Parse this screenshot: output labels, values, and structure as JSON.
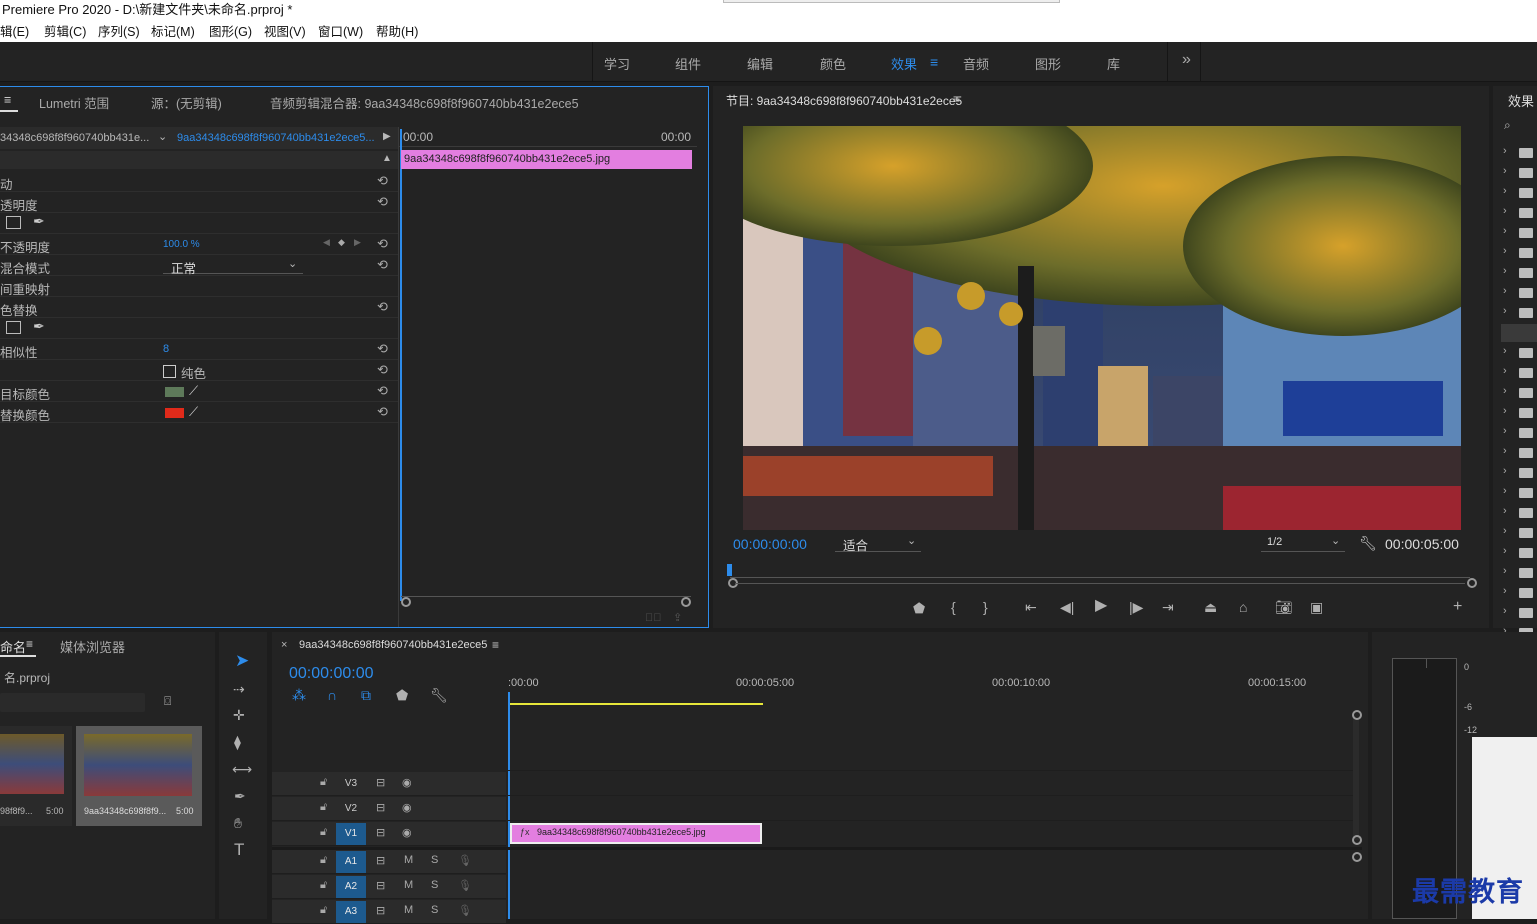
{
  "title": "Premiere Pro 2020 - D:\\新建文件夹\\未命名.prproj *",
  "menu": [
    "辑(E)",
    "剪辑(C)",
    "序列(S)",
    "标记(M)",
    "图形(G)",
    "视图(V)",
    "窗口(W)",
    "帮助(H)"
  ],
  "workspaces": [
    "学习",
    "组件",
    "编辑",
    "颜色",
    "效果",
    "音频",
    "图形",
    "库"
  ],
  "workspace_active": "效果",
  "workspace_overflow": "»",
  "effect_controls": {
    "tabs": [
      "Lumetri 范围",
      "源：(无剪辑)",
      "音频剪辑混合器: 9aa34348c698f8f960740bb431e2ece5"
    ],
    "master_clip": "34348c698f8f960740bb431e...",
    "sequence_clip": "9aa34348c698f8f960740bb431e2ece5...",
    "time_start": "00:00",
    "time_end": "00:00",
    "clip_name": "9aa34348c698f8f960740bb431e2ece5.jpg",
    "rows": [
      "动",
      "透明度",
      "",
      "不透明度",
      "混合模式",
      "间重映射",
      "色替换",
      "",
      "相似性",
      "",
      "目标颜色",
      "替换颜色"
    ],
    "opacity_value": "100.0 %",
    "blend_mode": "正常",
    "similarity": "8",
    "solid_color_label": "纯色",
    "target_color": "#5e7a5a",
    "replace_color": "#e02a1a"
  },
  "program": {
    "title": "节目: 9aa34348c698f8f960740bb431e2ece5",
    "timecode": "00:00:00:00",
    "fit": "适合",
    "resolution": "1/2",
    "duration": "00:00:05:00"
  },
  "effects_panel": {
    "title": "效果"
  },
  "project": {
    "tabs": [
      "命名",
      "媒体浏览器"
    ],
    "file": "名.prproj",
    "items": [
      {
        "name": "98f8f9...",
        "dur": "5:00"
      },
      {
        "name": "9aa34348c698f8f9...",
        "dur": "5:00"
      }
    ]
  },
  "timeline": {
    "seq_name": "9aa34348c698f8f960740bb431e2ece5",
    "timecode": "00:00:00:00",
    "ruler": [
      ":00:00",
      "00:00:05:00",
      "00:00:10:00",
      "00:00:15:00"
    ],
    "tracks": [
      "V3",
      "V2",
      "V1",
      "A1",
      "A2",
      "A3"
    ],
    "clip": "9aa34348c698f8f960740bb431e2ece5.jpg",
    "clip_color": "#e37ee0"
  },
  "meter": {
    "ticks": [
      "0",
      "-6",
      "-12"
    ]
  },
  "watermark": "最需教育"
}
